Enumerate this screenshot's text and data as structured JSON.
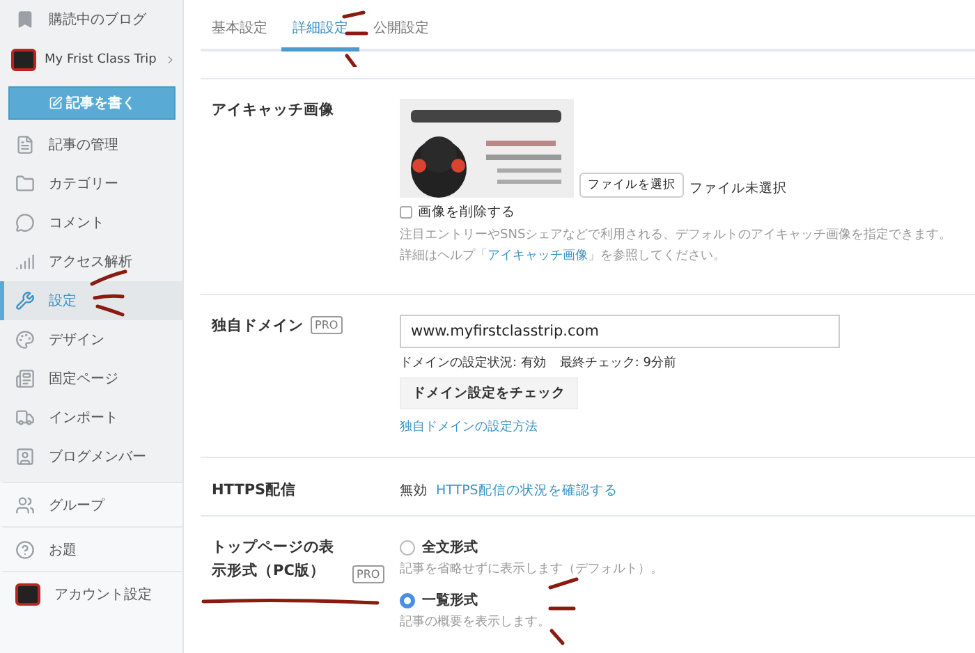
{
  "sidebar": {
    "top_link": {
      "label": "購読中のブログ"
    },
    "blog": {
      "name": "My Frist Class Trip"
    },
    "write_button": {
      "label": "記事を書く"
    },
    "items": [
      {
        "label": "記事の管理",
        "selected": false
      },
      {
        "label": "カテゴリー",
        "selected": false
      },
      {
        "label": "コメント",
        "selected": false
      },
      {
        "label": "アクセス解析",
        "selected": false
      },
      {
        "label": "設定",
        "selected": true
      },
      {
        "label": "デザイン",
        "selected": false
      },
      {
        "label": "固定ページ",
        "selected": false
      },
      {
        "label": "インポート",
        "selected": false
      },
      {
        "label": "ブログメンバー",
        "selected": false
      }
    ],
    "footer_items": [
      {
        "label": "グループ"
      },
      {
        "label": "お題"
      },
      {
        "label": "アカウント設定"
      }
    ]
  },
  "tabs": [
    {
      "label": "基本設定",
      "selected": false
    },
    {
      "label": "詳細設定",
      "selected": true
    },
    {
      "label": "公開設定",
      "selected": false
    }
  ],
  "eyecatch": {
    "label": "アイキャッチ画像",
    "file_button": "ファイルを選択",
    "file_status": "ファイル未選択",
    "delete_checkbox": {
      "label": "画像を削除する",
      "checked": false
    },
    "help": "注目エントリーやSNSシェアなどで利用される、デフォルトのアイキャッチ画像を指定できます。",
    "help_before": "詳細はヘルプ「",
    "help_link": "アイキャッチ画像",
    "help_after": "」を参照してください。"
  },
  "domain": {
    "label": "独自ドメイン",
    "badge": "PRO",
    "value": "www.myfirstclasstrip.com",
    "status": "ドメインの設定状況: 有効",
    "last_check": "最終チェック: 9分前",
    "check_button": "ドメイン設定をチェック",
    "link": "独自ドメインの設定方法"
  },
  "https": {
    "label": "HTTPS配信",
    "status": "無効",
    "link": "HTTPS配信の状況を確認する"
  },
  "top_page": {
    "label": "トップページの表示形式（PC版）",
    "badge": "PRO",
    "options": [
      {
        "label": "全文形式",
        "description": "記事を省略せずに表示します（デフォルト）。",
        "selected": false
      },
      {
        "label": "一覧形式",
        "description": "記事の概要を表示します。",
        "selected": true
      }
    ]
  }
}
